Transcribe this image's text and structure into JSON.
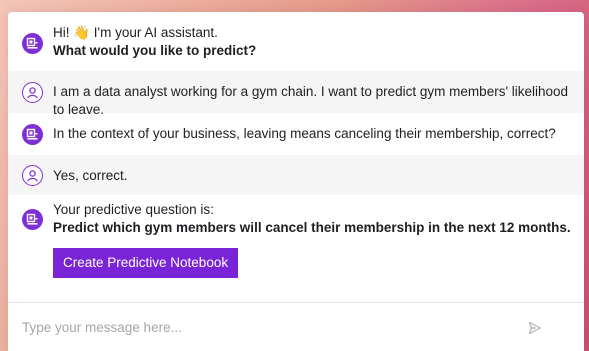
{
  "conversation": [
    {
      "role": "assistant",
      "lines": [
        {
          "text": "Hi! 👋 I'm your AI assistant.",
          "bold": false
        },
        {
          "text": "What would you like to predict?",
          "bold": true
        }
      ]
    },
    {
      "role": "user",
      "lines": [
        {
          "text": "I am a data analyst working for a gym chain. I want to predict gym members' likelihood to leave.",
          "bold": false
        }
      ]
    },
    {
      "role": "assistant",
      "lines": [
        {
          "text": "In the context of your business, leaving means canceling their membership, correct?",
          "bold": false
        }
      ]
    },
    {
      "role": "user",
      "lines": [
        {
          "text": "Yes, correct.",
          "bold": false
        }
      ]
    },
    {
      "role": "assistant",
      "lines": [
        {
          "text": "Your predictive question is:",
          "bold": false
        },
        {
          "text": "Predict which gym members will cancel their membership in the next 12 months.",
          "bold": true
        }
      ]
    }
  ],
  "cta": {
    "label": "Create Predictive Notebook"
  },
  "input": {
    "placeholder": "Type your message here...",
    "value": ""
  },
  "icons": {
    "assistant": "bot-icon",
    "user": "user-icon",
    "send": "send-icon"
  },
  "colors": {
    "accent": "#7a24d8",
    "user_bg": "#f5f5f6"
  }
}
